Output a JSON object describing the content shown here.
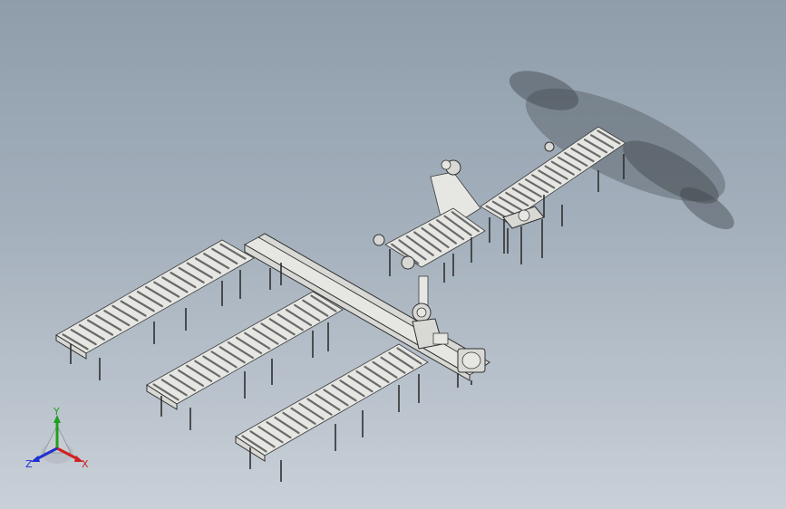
{
  "viewport": {
    "background_top": "#8f9dab",
    "background_bottom": "#c9d0d8",
    "model": "conveyor-line-assembly"
  },
  "triad": {
    "x_label": "X",
    "y_label": "Y",
    "z_label": "Z",
    "x_color": "#d02020",
    "y_color": "#20a020",
    "z_color": "#2030d0"
  }
}
